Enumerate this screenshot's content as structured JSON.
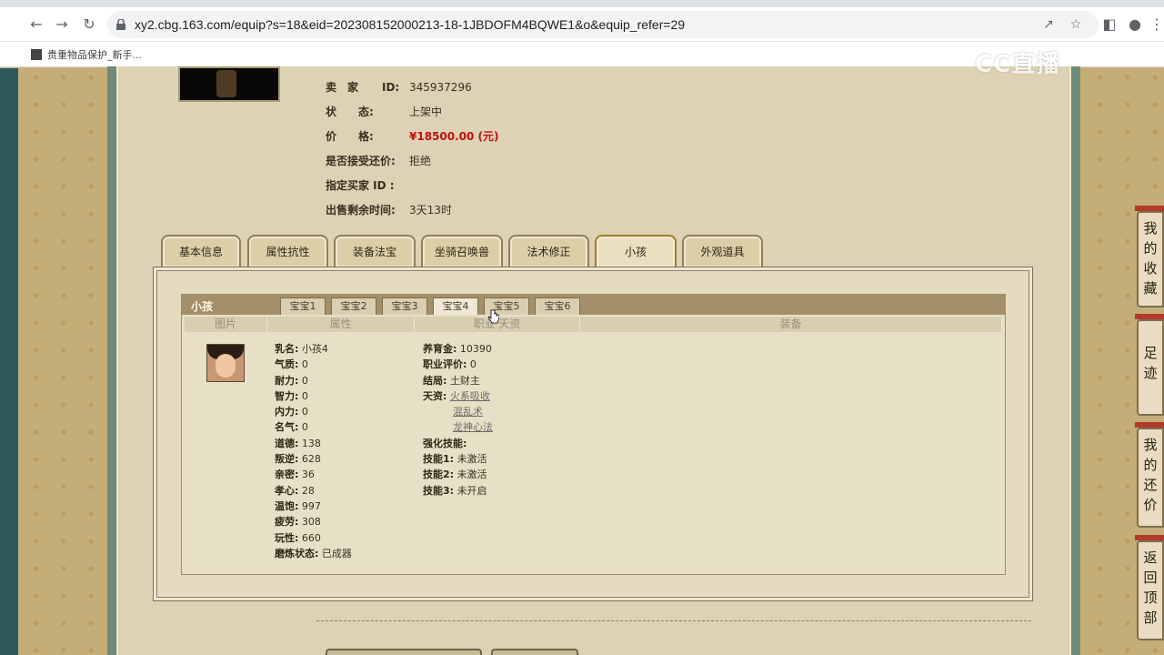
{
  "browser": {
    "url": "xy2.cbg.163.com/equip?s=18&eid=202308152000213-18-1JBDOFM4BQWE1&o&equip_refer=29",
    "bookmark_label": "贵重物品保护_新手..."
  },
  "watermark": "CC直播",
  "seller": {
    "seller_label": "卖　家",
    "id_label": "ID:",
    "seller_id": "345937296",
    "status_label": "状　　态:",
    "status_value": "上架中",
    "price_label": "价　　格:",
    "price_value": "¥18500.00 (元)",
    "counter_label": "是否接受还价:",
    "counter_value": "拒绝",
    "buyer_label": "指定买家 ID :",
    "remaining_label": "出售剩余时间:",
    "remaining_value": "3天13时"
  },
  "tabs": [
    "基本信息",
    "属性抗性",
    "装备法宝",
    "坐骑召唤兽",
    "法术修正",
    "小孩",
    "外观道具"
  ],
  "active_tab": "小孩",
  "child_panel": {
    "title": "小孩",
    "subtabs": [
      "宝宝1",
      "宝宝2",
      "宝宝3",
      "宝宝4",
      "宝宝5",
      "宝宝6"
    ],
    "active_subtab": "宝宝4",
    "columns": [
      "图片",
      "属性",
      "职业 天资",
      "装备"
    ],
    "attributes": [
      {
        "label": "乳名:",
        "value": "小孩4"
      },
      {
        "label": "气质:",
        "value": "0"
      },
      {
        "label": "耐力:",
        "value": "0"
      },
      {
        "label": "智力:",
        "value": "0"
      },
      {
        "label": "内力:",
        "value": "0"
      },
      {
        "label": "名气:",
        "value": "0"
      },
      {
        "label": "道德:",
        "value": "138"
      },
      {
        "label": "叛逆:",
        "value": "628"
      },
      {
        "label": "亲密:",
        "value": "36"
      },
      {
        "label": "孝心:",
        "value": "28"
      },
      {
        "label": "温饱:",
        "value": "997"
      },
      {
        "label": "疲劳:",
        "value": "308"
      },
      {
        "label": "玩性:",
        "value": "660"
      },
      {
        "label": "磨炼状态:",
        "value": "已成器"
      }
    ],
    "career": {
      "fund_label": "养育金:",
      "fund_value": "10390",
      "eval_label": "职业评价:",
      "eval_value": "0",
      "ending_label": "结局:",
      "ending_value": "土财主",
      "talent_label": "天资:",
      "talents": [
        "火系吸收",
        "混乱术",
        "龙神心法"
      ],
      "enhance_label": "强化技能:",
      "skills": [
        {
          "label": "技能1:",
          "value": "未激活"
        },
        {
          "label": "技能2:",
          "value": "未激活"
        },
        {
          "label": "技能3:",
          "value": "未开启"
        }
      ]
    }
  },
  "side_buttons": [
    "我的收藏",
    "足迹",
    "我的还价",
    "返回顶部"
  ]
}
